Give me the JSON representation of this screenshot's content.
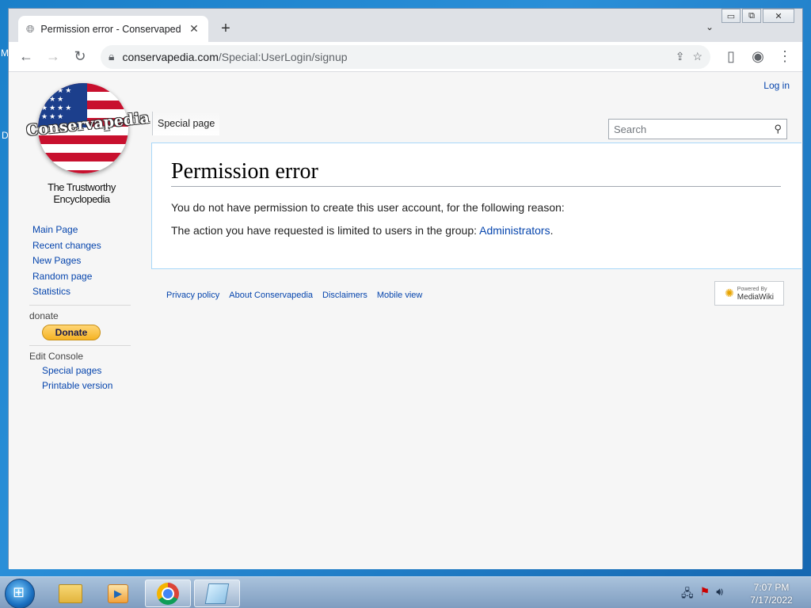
{
  "desktop": {
    "frag_m": "M",
    "frag_d": "D"
  },
  "browser": {
    "tab_title": "Permission error - Conservapedia",
    "tab_close": "✕",
    "new_tab": "+",
    "url_host": "conservapedia.com",
    "url_path": "/Special:UserLogin/signup",
    "window_controls": {
      "minimize": "▭",
      "restore": "⧉",
      "close": "✕"
    }
  },
  "page": {
    "login_link": "Log in",
    "logo_text": "Conservapedia",
    "logo_tagline": "The Trustworthy Encyclopedia",
    "special_tab": "Special page",
    "search_placeholder": "Search",
    "heading": "Permission error",
    "paragraph1": "You do not have permission to create this user account, for the following reason:",
    "paragraph2_prefix": "The action you have requested is limited to users in the group: ",
    "paragraph2_link": "Administrators",
    "paragraph2_suffix": ".",
    "sidebar": {
      "nav": [
        "Main Page",
        "Recent changes",
        "New Pages",
        "Random page",
        "Statistics"
      ],
      "donate_heading": "donate",
      "donate_button": "Donate",
      "edit_console_heading": "Edit Console",
      "edit_console": [
        "Special pages",
        "Printable version"
      ]
    },
    "footer": [
      "Privacy policy",
      "About Conservapedia",
      "Disclaimers",
      "Mobile view"
    ],
    "mediawiki_badge": {
      "line1": "Powered By",
      "line2": "MediaWiki"
    }
  },
  "taskbar": {
    "time": "7:07 PM",
    "date": "7/17/2022"
  },
  "colors": {
    "link": "#0645ad",
    "accent": "#a7d7f9"
  }
}
